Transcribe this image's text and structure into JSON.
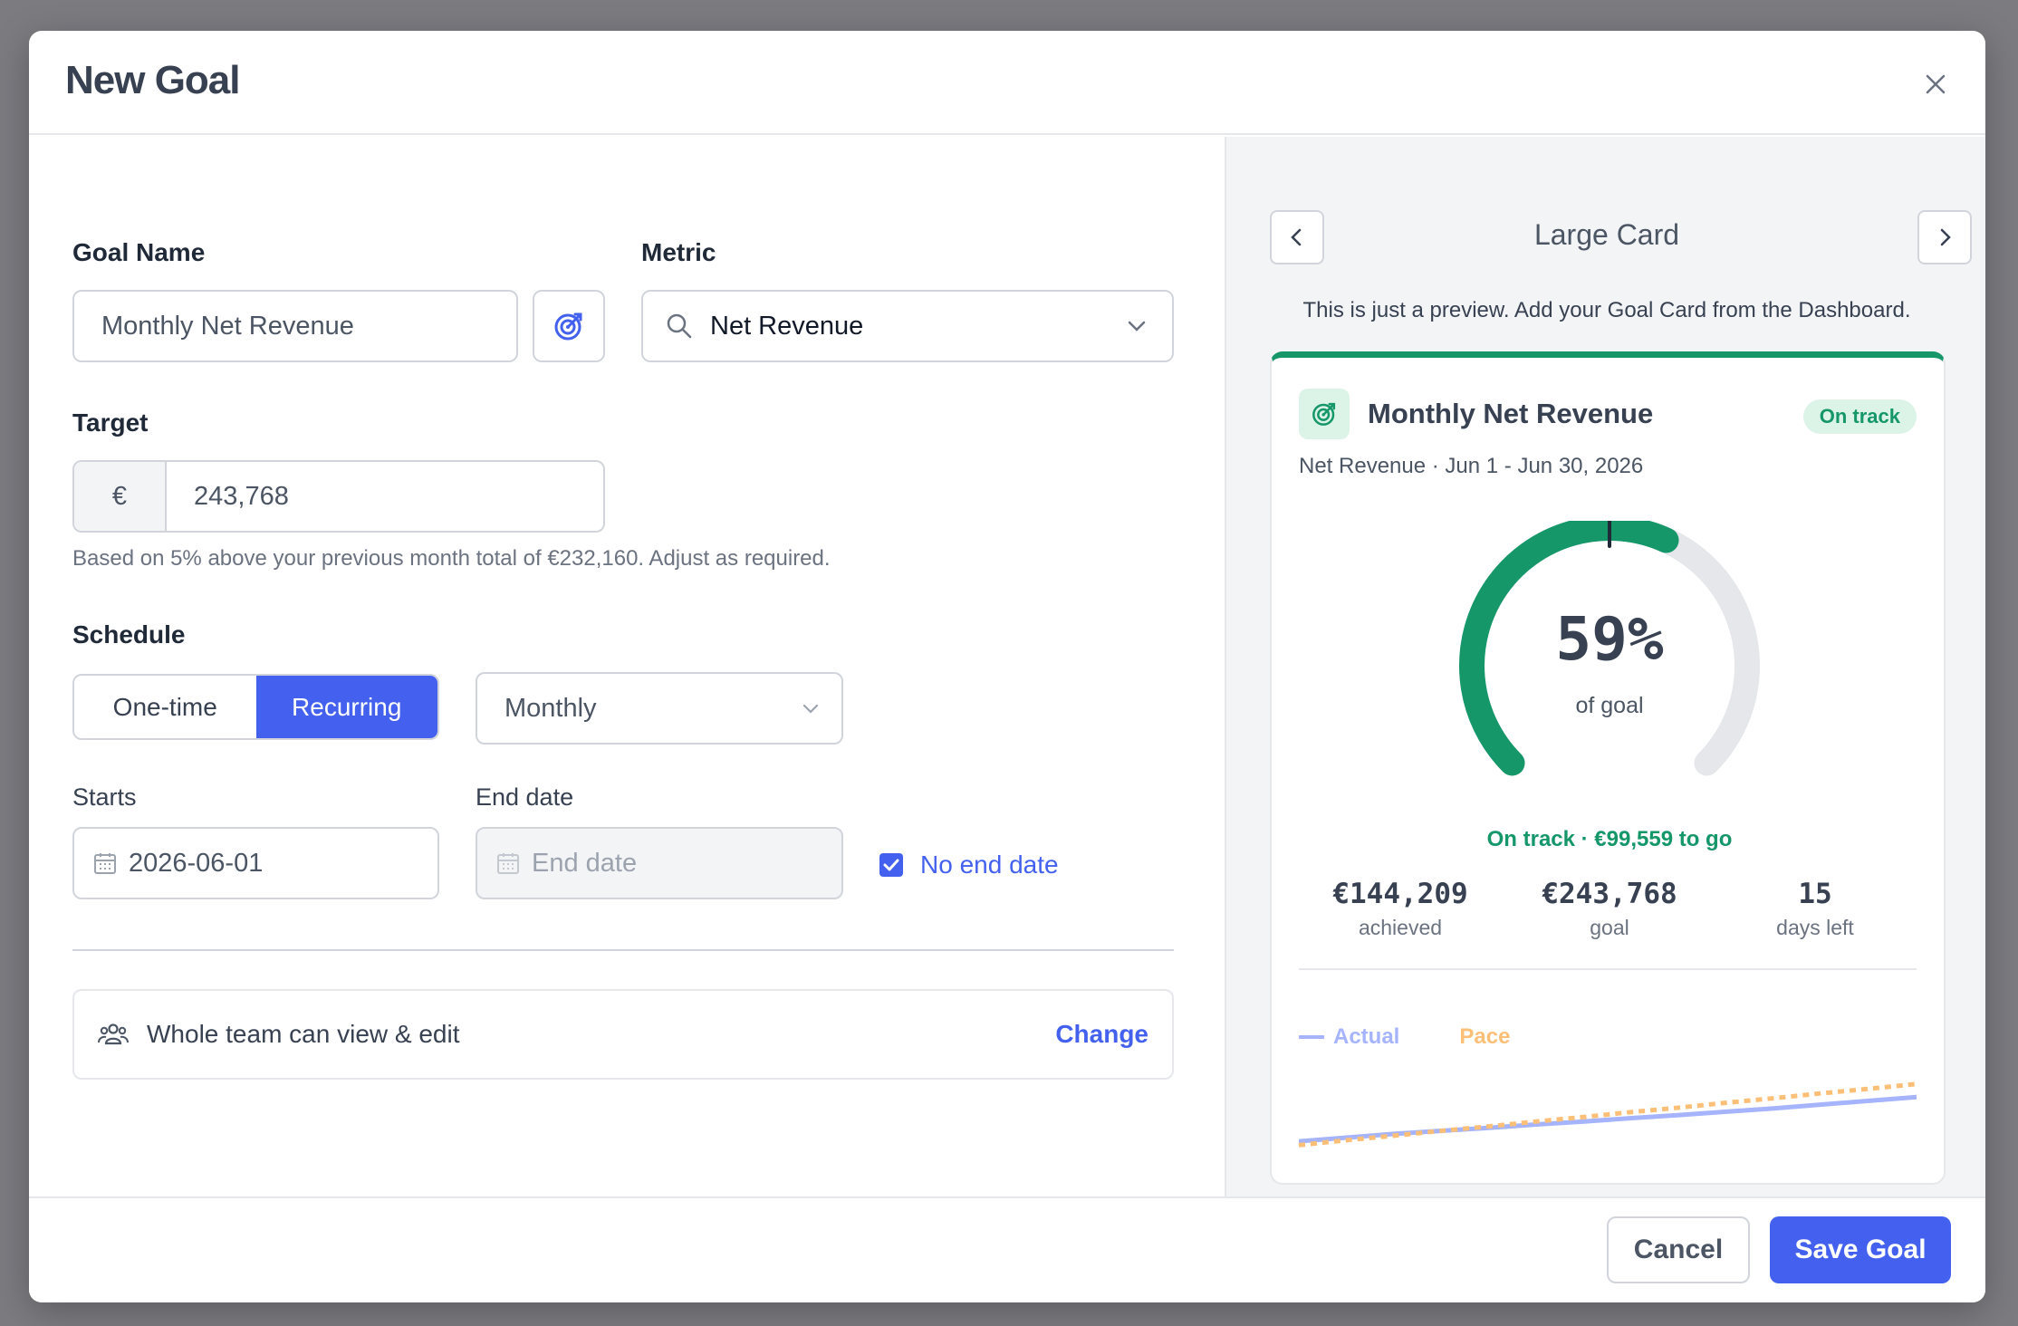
{
  "modal": {
    "title": "New Goal"
  },
  "form": {
    "goal_name_label": "Goal Name",
    "goal_name_value": "Monthly Net Revenue",
    "metric_label": "Metric",
    "metric_value": "Net Revenue",
    "target_label": "Target",
    "currency_symbol": "€",
    "target_value": "243,768",
    "target_hint": "Based on 5% above your previous month total of €232,160. Adjust as required.",
    "schedule_label": "Schedule",
    "schedule_options": [
      "One-time",
      "Recurring"
    ],
    "schedule_selected": "Recurring",
    "frequency_value": "Monthly",
    "starts_label": "Starts",
    "starts_value": "2026-06-01",
    "end_date_label": "End date",
    "end_date_placeholder": "End date",
    "no_end_date_label": "No end date",
    "no_end_date_checked": true,
    "sharing_text": "Whole team can view & edit",
    "sharing_change": "Change"
  },
  "preview": {
    "size_label": "Large Card",
    "note": "This is just a preview. Add your Goal Card from the Dashboard.",
    "card": {
      "title": "Monthly Net Revenue",
      "badge": "On track",
      "subtitle": "Net Revenue · Jun 1 - Jun 30, 2026",
      "percent_text": "59%",
      "percent_value": 0.59,
      "pace_marker": 0.5,
      "of_goal": "of goal",
      "status_line": "On track · €99,559 to go",
      "achieved_value": "€144,209",
      "achieved_label": "achieved",
      "goal_value": "€243,768",
      "goal_label": "goal",
      "days_value": "15",
      "days_label": "days left"
    }
  },
  "chart_data": {
    "type": "line",
    "legend": [
      "Actual",
      "Pace"
    ],
    "series": [
      {
        "name": "Actual",
        "values": [
          6.0,
          7.0,
          8.0,
          8.8,
          9.6,
          10.5,
          11.3,
          12.2,
          13.0,
          13.9,
          14.8,
          15.8,
          16.8,
          17.8
        ]
      },
      {
        "name": "Pace",
        "values": [
          5.0,
          6.3,
          7.5,
          8.8,
          10.0,
          11.3,
          12.5,
          13.8,
          15.0,
          16.3,
          17.5,
          18.8,
          20.0,
          21.3
        ]
      }
    ],
    "colors": {
      "Actual": "#a5b4fc",
      "Pace": "#fbbf77"
    }
  },
  "footer": {
    "cancel_label": "Cancel",
    "save_label": "Save Goal"
  },
  "colors": {
    "primary": "#4361ee",
    "success": "#15976a",
    "track": "#e5e7eb"
  }
}
